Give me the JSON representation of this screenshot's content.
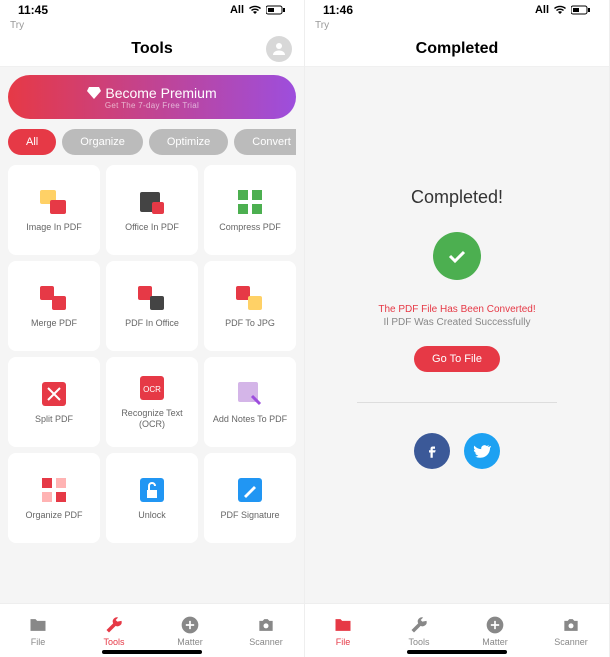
{
  "colors": {
    "accent": "#e63946",
    "success": "#4caf50",
    "facebook": "#3b5998",
    "twitter": "#1da1f2"
  },
  "left": {
    "status": {
      "time": "11:45",
      "carrier": "All",
      "try": "Try"
    },
    "header": {
      "title": "Tools"
    },
    "premium": {
      "title": "Become Premium",
      "subtitle": "Get The 7-day Free Trial"
    },
    "tabs": [
      "All",
      "Organize",
      "Optimize",
      "Convert"
    ],
    "active_tab": 0,
    "tools": [
      {
        "label": "Image In PDF",
        "icon": "image-to-pdf"
      },
      {
        "label": "Office In PDF",
        "icon": "office-to-pdf"
      },
      {
        "label": "Compress PDF",
        "icon": "compress"
      },
      {
        "label": "Merge PDF",
        "icon": "merge"
      },
      {
        "label": "PDF In Office",
        "icon": "pdf-to-office"
      },
      {
        "label": "PDF To JPG",
        "icon": "pdf-to-jpg"
      },
      {
        "label": "Split PDF",
        "icon": "split"
      },
      {
        "label": "Recognize Text (OCR)",
        "icon": "ocr"
      },
      {
        "label": "Add Notes To PDF",
        "icon": "notes"
      },
      {
        "label": "Organize PDF",
        "icon": "organize"
      },
      {
        "label": "Unlock",
        "icon": "unlock"
      },
      {
        "label": "PDF Signature",
        "icon": "signature"
      }
    ],
    "nav": [
      {
        "label": "File",
        "icon": "folder"
      },
      {
        "label": "Tools",
        "icon": "wrench"
      },
      {
        "label": "Matter",
        "icon": "plus"
      },
      {
        "label": "Scanner",
        "icon": "camera"
      }
    ],
    "active_nav": 1
  },
  "right": {
    "status": {
      "time": "11:46",
      "carrier": "All",
      "try": "Try"
    },
    "header": {
      "title": "Completed"
    },
    "completed": {
      "title": "Completed!",
      "msg1": "The PDF File Has Been Converted!",
      "msg2": "Il PDF Was Created Successfully",
      "button": "Go To File"
    },
    "nav": [
      {
        "label": "File",
        "icon": "folder"
      },
      {
        "label": "Tools",
        "icon": "wrench"
      },
      {
        "label": "Matter",
        "icon": "plus"
      },
      {
        "label": "Scanner",
        "icon": "camera"
      }
    ],
    "active_nav": 0
  }
}
